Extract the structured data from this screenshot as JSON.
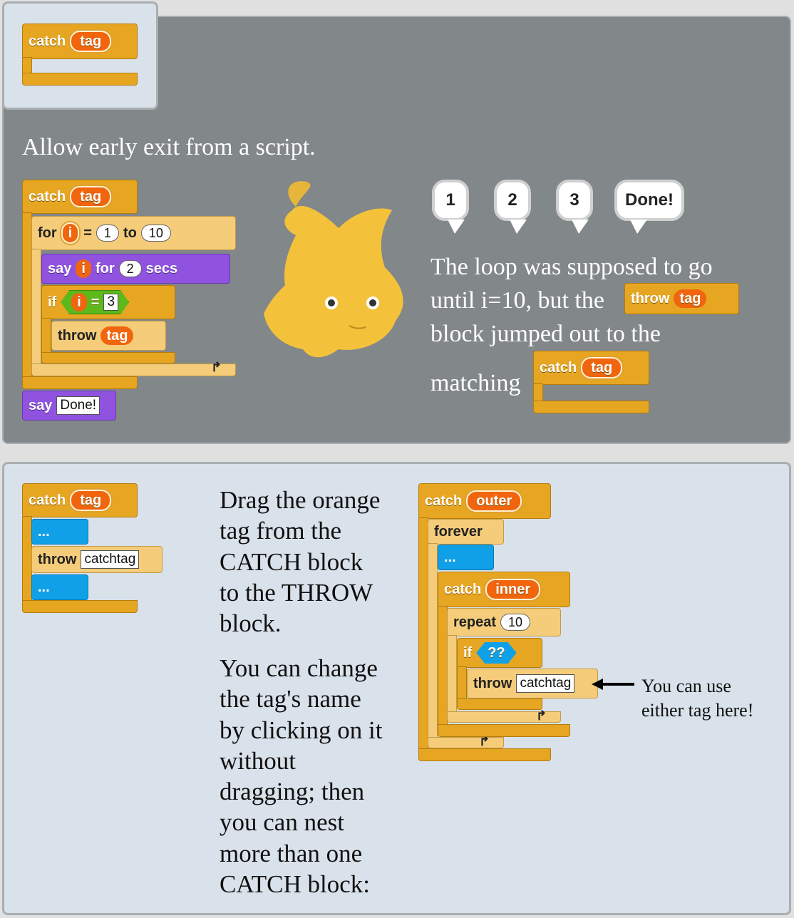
{
  "top": {
    "tab_block": {
      "keyword": "catch",
      "tag": "tag"
    },
    "heading": "Allow early exit from a script.",
    "script": {
      "catch_keyword": "catch",
      "catch_tag": "tag",
      "for_keyword": "for",
      "for_var": "i",
      "eq": "=",
      "from": "1",
      "to_keyword": "to",
      "to": "10",
      "say_keyword": "say",
      "say_var": "i",
      "for_word": "for",
      "secs_value": "2",
      "secs_word": "secs",
      "if_keyword": "if",
      "if_var": "i",
      "if_eq": "=",
      "if_value": "3",
      "throw_keyword": "throw",
      "throw_tag": "tag",
      "say2_keyword": "say",
      "say2_value": "Done!"
    },
    "bubbles": [
      "1",
      "2",
      "3",
      "Done!"
    ],
    "explanation": {
      "line1": "The loop was supposed to go",
      "line2": "until i=10, but the",
      "inline_throw": "throw",
      "inline_throw_tag": "tag",
      "line3": "block jumped out to the",
      "line4": "matching",
      "inline_catch": "catch",
      "inline_catch_tag": "tag"
    }
  },
  "bottom": {
    "left_script": {
      "catch_keyword": "catch",
      "catch_tag": "tag",
      "dots1": "...",
      "throw_keyword": "throw",
      "throw_value": "catchtag",
      "dots2": "..."
    },
    "paragraph1": [
      "Drag the orange",
      "tag from the",
      "CATCH block",
      "to the THROW",
      "block."
    ],
    "paragraph2": [
      "You can change",
      "the tag's name",
      "by clicking on it",
      "without",
      "dragging; then",
      "you can nest",
      "more than one",
      "CATCH block:"
    ],
    "right_script": {
      "catch_keyword": "catch",
      "catch_tag": "outer",
      "forever_keyword": "forever",
      "dots": "...",
      "inner_catch_keyword": "catch",
      "inner_catch_tag": "inner",
      "repeat_keyword": "repeat",
      "repeat_value": "10",
      "if_keyword": "if",
      "if_value": "??",
      "throw_keyword": "throw",
      "throw_value": "catchtag"
    },
    "annotation": [
      "You can use",
      "either tag here!"
    ]
  }
}
